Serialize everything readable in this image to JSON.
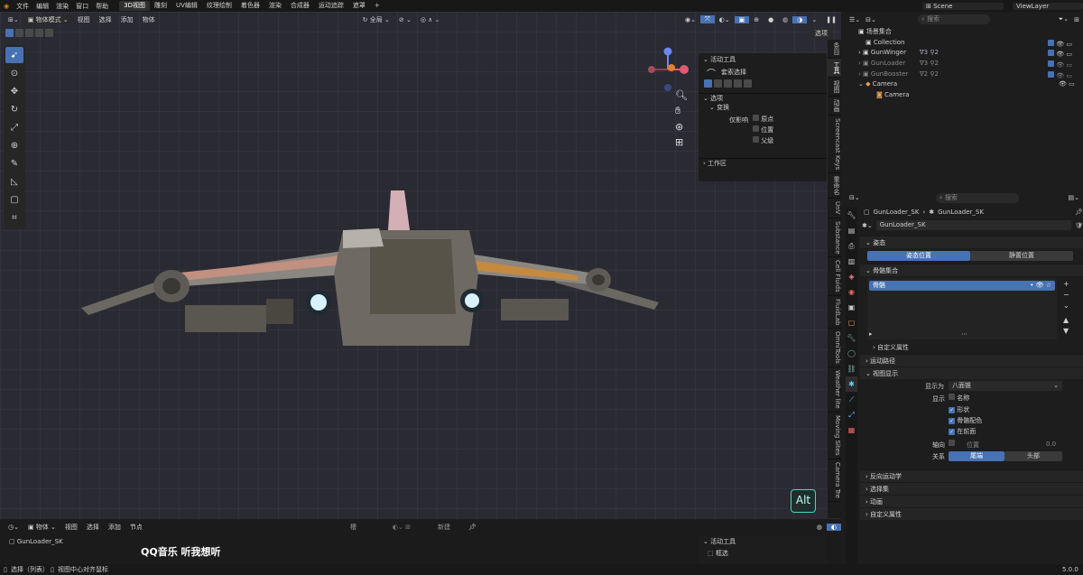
{
  "topbar": {
    "menus": [
      "文件",
      "编辑",
      "渲染",
      "窗口",
      "帮助"
    ],
    "workspaces": [
      "3D视图",
      "雕刻",
      "UV编辑",
      "纹理绘制",
      "着色器",
      "渲染",
      "合成器",
      "运动追踪",
      "遮罩"
    ],
    "add_tab": "+",
    "scene": "Scene",
    "view_layer": "ViewLayer"
  },
  "viewport": {
    "mode": "物体模式",
    "menus": [
      "视图",
      "选择",
      "添加",
      "物体"
    ],
    "transform": "全局",
    "options": "选项",
    "alt_badge": "Alt"
  },
  "npanel": {
    "active_tool_head": "活动工具",
    "tool_name": "套索选择",
    "options_head": "选项",
    "transform_head": "变换",
    "affect_only": "仅影响",
    "origins": "原点",
    "locations": "位置",
    "parents": "父级",
    "workspace_head": "工作区"
  },
  "vtabs": [
    "条目",
    "工具",
    "视图",
    "动画",
    "Screencast Keys",
    "重命名",
    "UnV",
    "Substance",
    "Cell Fluids",
    "FluidLab",
    "OmniTools",
    "Weather lite",
    "Moving Sites",
    "Camera Tre"
  ],
  "outliner": {
    "search_placeholder": "搜索",
    "scene_collection": "场景集合",
    "rows": [
      {
        "name": "Collection",
        "depth": 1,
        "expand": ""
      },
      {
        "name": "GunWinger",
        "depth": 1,
        "expand": "›",
        "suffix": "∇3 ⚲2"
      },
      {
        "name": "GunLoader",
        "depth": 1,
        "expand": "›",
        "suffix": "∇3 ⚲2"
      },
      {
        "name": "GunBooster",
        "depth": 1,
        "expand": "›",
        "suffix": "∇2 ⚲2"
      },
      {
        "name": "Camera",
        "depth": 1,
        "expand": "⌄",
        "suffix": ""
      },
      {
        "name": "Camera",
        "depth": 2,
        "expand": "",
        "suffix": ""
      }
    ]
  },
  "props": {
    "search_placeholder": "搜索",
    "breadcrumb_obj": "GunLoader_SK",
    "breadcrumb_data": "GunLoader_SK",
    "data_name": "GunLoader_SK",
    "pose_head": "姿态",
    "pose_position": "姿态位置",
    "rest_position": "静置位置",
    "bone_collections_head": "骨骼集合",
    "bone_collection_item": "骨骼",
    "custom_props": "自定义属性",
    "motion_paths": "运动路径",
    "viewport_display": "视图显示",
    "display_as_label": "显示为",
    "display_as_value": "八面锥",
    "show_label": "显示",
    "show_names": "名称",
    "show_shapes": "形状",
    "show_bone_colors": "骨骼配色",
    "show_in_front": "在前面",
    "axes_label": "轴向",
    "axes_position": "位置",
    "axes_value": "0.0",
    "relations_label": "关系",
    "relations_tail": "尾端",
    "relations_head": "头部",
    "inverse_kinematics": "反向运动学",
    "selection_sets": "选择集",
    "animation": "动画",
    "custom_props2": "自定义属性"
  },
  "timeline": {
    "object_menu": "物体",
    "menus": [
      "视图",
      "选择",
      "添加",
      "节点"
    ],
    "slot": "槽",
    "new_btn": "新建",
    "object_name": "GunLoader_SK",
    "watermark": "QQ音乐 听我想听",
    "active_tool": "活动工具",
    "tool_name": "框选"
  },
  "status": {
    "select_hint": "选择（列表）",
    "center_hint": "视图中心对齐鼠标",
    "version": "5.0.0"
  }
}
